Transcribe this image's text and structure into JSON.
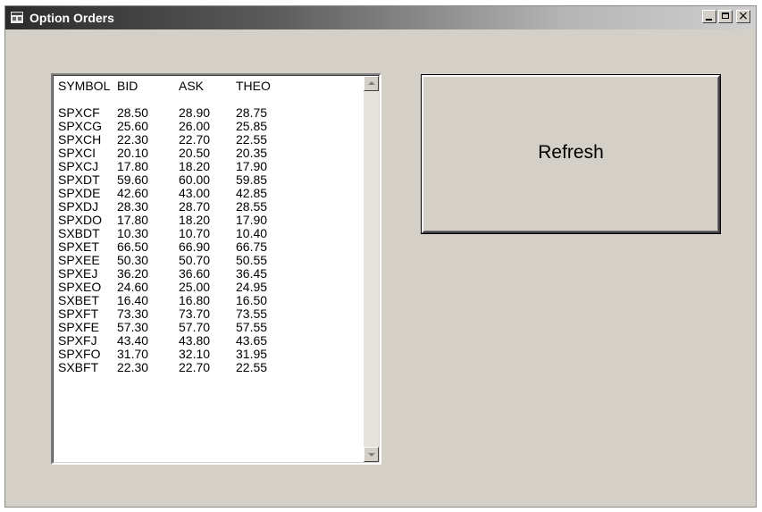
{
  "window": {
    "title": "Option Orders"
  },
  "titlebar_buttons": {
    "minimize_icon": "minimize-icon",
    "maximize_icon": "maximize-icon",
    "close_icon": "close-icon",
    "close_glyph": "×"
  },
  "list": {
    "headers": [
      "SYMBOL",
      "BID",
      "ASK",
      "THEO"
    ],
    "rows": [
      [
        "SPXCF",
        "28.50",
        "28.90",
        "28.75"
      ],
      [
        "SPXCG",
        "25.60",
        "26.00",
        "25.85"
      ],
      [
        "SPXCH",
        "22.30",
        "22.70",
        "22.55"
      ],
      [
        "SPXCI",
        "20.10",
        "20.50",
        "20.35"
      ],
      [
        "SPXCJ",
        "17.80",
        "18.20",
        "17.90"
      ],
      [
        "SPXDT",
        "59.60",
        "60.00",
        "59.85"
      ],
      [
        "SPXDE",
        "42.60",
        "43.00",
        "42.85"
      ],
      [
        "SPXDJ",
        "28.30",
        "28.70",
        "28.55"
      ],
      [
        "SPXDO",
        "17.80",
        "18.20",
        "17.90"
      ],
      [
        "SXBDT",
        "10.30",
        "10.70",
        "10.40"
      ],
      [
        "SPXET",
        "66.50",
        "66.90",
        "66.75"
      ],
      [
        "SPXEE",
        "50.30",
        "50.70",
        "50.55"
      ],
      [
        "SPXEJ",
        "36.20",
        "36.60",
        "36.45"
      ],
      [
        "SPXEO",
        "24.60",
        "25.00",
        "24.95"
      ],
      [
        "SXBET",
        "16.40",
        "16.80",
        "16.50"
      ],
      [
        "SPXFT",
        "73.30",
        "73.70",
        "73.55"
      ],
      [
        "SPXFE",
        "57.30",
        "57.70",
        "57.55"
      ],
      [
        "SPXFJ",
        "43.40",
        "43.80",
        "43.65"
      ],
      [
        "SPXFO",
        "31.70",
        "32.10",
        "31.95"
      ],
      [
        "SXBFT",
        "22.30",
        "22.70",
        "22.55"
      ]
    ]
  },
  "refresh_button": {
    "label": "Refresh"
  }
}
